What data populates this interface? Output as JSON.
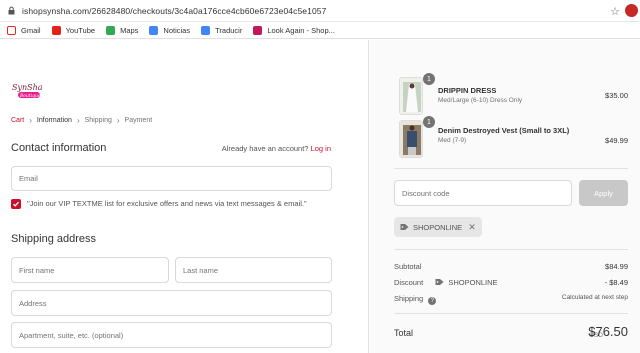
{
  "browser": {
    "url": "ishopsynsha.com/26628480/checkouts/3c4a0a176cce4cb60e6723e04c5e1057",
    "bookmarks": [
      {
        "label": "Gmail",
        "icon": "gmail-icon",
        "color": "#d93025"
      },
      {
        "label": "YouTube",
        "icon": "youtube-icon",
        "color": "#e62117"
      },
      {
        "label": "Maps",
        "icon": "maps-icon",
        "color": "#34a853"
      },
      {
        "label": "Noticias",
        "icon": "news-icon",
        "color": "#4285f4"
      },
      {
        "label": "Traducir",
        "icon": "translate-icon",
        "color": "#4285f4"
      },
      {
        "label": "Look Again - Shop...",
        "icon": "lookagain-icon",
        "color": "#c2185b"
      }
    ]
  },
  "brand": {
    "accent": "#c8102e"
  },
  "breadcrumb": {
    "cart": "Cart",
    "information": "Information",
    "shipping": "Shipping",
    "payment": "Payment"
  },
  "contact": {
    "title": "Contact information",
    "account_prompt": "Already have an account?",
    "login_link": "Log in",
    "email_placeholder": "Email",
    "sms_label": "\"Join our VIP TEXTME list for exclusive offers and news via text messages & email.\""
  },
  "shipping": {
    "title": "Shipping address",
    "first_name_placeholder": "First name",
    "last_name_placeholder": "Last name",
    "address_placeholder": "Address",
    "apartment_placeholder": "Apartment, suite, etc. (optional)"
  },
  "order": {
    "items": [
      {
        "qty": "1",
        "name": "DRIPPIN DRESS",
        "variant": "Med/Large (6-10) Dress Only",
        "price": "$35.00"
      },
      {
        "qty": "1",
        "name": "Denim Destroyed Vest (Small to 3XL)",
        "variant": "Med (7-9)",
        "price": "$49.99"
      }
    ],
    "discount_placeholder": "Discount code",
    "apply_label": "Apply",
    "applied_code": "SHOPONLINE",
    "subtotal_label": "Subtotal",
    "subtotal_value": "$84.99",
    "discount_label": "Discount",
    "discount_code": "SHOPONLINE",
    "discount_value": "- $8.49",
    "shipping_label": "Shipping",
    "shipping_value": "Calculated at next step",
    "total_label": "Total",
    "currency": "USD",
    "total_value": "$76.50"
  }
}
